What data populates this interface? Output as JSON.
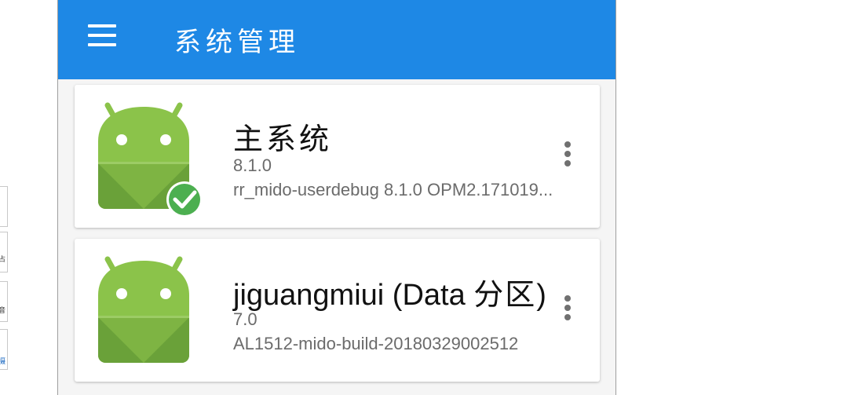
{
  "browser_side": {
    "tabs": [
      {
        "label": ""
      },
      {
        "label": "占"
      },
      {
        "label": "音"
      },
      {
        "label": "摄"
      }
    ]
  },
  "app": {
    "title": "系统管理",
    "colors": {
      "app_bar": "#1e88e5",
      "android_green": "#8bc34a",
      "check_green": "#4caf50"
    }
  },
  "systems": [
    {
      "name": "主系统",
      "version": "8.1.0",
      "build": "rr_mido-userdebug 8.1.0 OPM2.171019...",
      "active": true,
      "icon": "android-robot-icon"
    },
    {
      "name_prefix": "jiguangmiui (Data ",
      "name_cjk": "分区",
      "name_suffix": ")",
      "version": "7.0",
      "build": "AL1512-mido-build-20180329002512",
      "active": false,
      "icon": "android-robot-icon"
    }
  ]
}
